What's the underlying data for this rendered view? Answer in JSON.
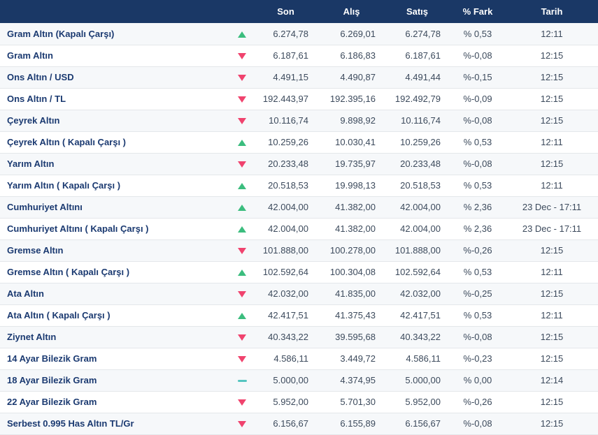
{
  "table": {
    "columns": {
      "name": "",
      "trend": "",
      "son": "Son",
      "alis": "Alış",
      "satis": "Satış",
      "fark": "% Fark",
      "tarih": "Tarih"
    },
    "rows": [
      {
        "name": "Gram Altın (Kapalı Çarşı)",
        "trend": "up",
        "son": "6.274,78",
        "alis": "6.269,01",
        "satis": "6.274,78",
        "fark": "% 0,53",
        "tarih": "12:11"
      },
      {
        "name": "Gram Altın",
        "trend": "down",
        "son": "6.187,61",
        "alis": "6.186,83",
        "satis": "6.187,61",
        "fark": "%-0,08",
        "tarih": "12:15"
      },
      {
        "name": "Ons Altın / USD",
        "trend": "down",
        "son": "4.491,15",
        "alis": "4.490,87",
        "satis": "4.491,44",
        "fark": "%-0,15",
        "tarih": "12:15"
      },
      {
        "name": "Ons Altın / TL",
        "trend": "down",
        "son": "192.443,97",
        "alis": "192.395,16",
        "satis": "192.492,79",
        "fark": "%-0,09",
        "tarih": "12:15"
      },
      {
        "name": "Çeyrek Altın",
        "trend": "down",
        "son": "10.116,74",
        "alis": "9.898,92",
        "satis": "10.116,74",
        "fark": "%-0,08",
        "tarih": "12:15"
      },
      {
        "name": "Çeyrek Altın ( Kapalı Çarşı )",
        "trend": "up",
        "son": "10.259,26",
        "alis": "10.030,41",
        "satis": "10.259,26",
        "fark": "% 0,53",
        "tarih": "12:11"
      },
      {
        "name": "Yarım Altın",
        "trend": "down",
        "son": "20.233,48",
        "alis": "19.735,97",
        "satis": "20.233,48",
        "fark": "%-0,08",
        "tarih": "12:15"
      },
      {
        "name": "Yarım Altın ( Kapalı Çarşı )",
        "trend": "up",
        "son": "20.518,53",
        "alis": "19.998,13",
        "satis": "20.518,53",
        "fark": "% 0,53",
        "tarih": "12:11"
      },
      {
        "name": "Cumhuriyet Altını",
        "trend": "up",
        "son": "42.004,00",
        "alis": "41.382,00",
        "satis": "42.004,00",
        "fark": "% 2,36",
        "tarih": "23 Dec - 17:11"
      },
      {
        "name": "Cumhuriyet Altını ( Kapalı Çarşı )",
        "trend": "up",
        "son": "42.004,00",
        "alis": "41.382,00",
        "satis": "42.004,00",
        "fark": "% 2,36",
        "tarih": "23 Dec - 17:11"
      },
      {
        "name": "Gremse Altın",
        "trend": "down",
        "son": "101.888,00",
        "alis": "100.278,00",
        "satis": "101.888,00",
        "fark": "%-0,26",
        "tarih": "12:15"
      },
      {
        "name": "Gremse Altın ( Kapalı Çarşı )",
        "trend": "up",
        "son": "102.592,64",
        "alis": "100.304,08",
        "satis": "102.592,64",
        "fark": "% 0,53",
        "tarih": "12:11"
      },
      {
        "name": "Ata Altın",
        "trend": "down",
        "son": "42.032,00",
        "alis": "41.835,00",
        "satis": "42.032,00",
        "fark": "%-0,25",
        "tarih": "12:15"
      },
      {
        "name": "Ata Altın ( Kapalı Çarşı )",
        "trend": "up",
        "son": "42.417,51",
        "alis": "41.375,43",
        "satis": "42.417,51",
        "fark": "% 0,53",
        "tarih": "12:11"
      },
      {
        "name": "Ziynet Altın",
        "trend": "down",
        "son": "40.343,22",
        "alis": "39.595,68",
        "satis": "40.343,22",
        "fark": "%-0,08",
        "tarih": "12:15"
      },
      {
        "name": "14 Ayar Bilezik Gram",
        "trend": "down",
        "son": "4.586,11",
        "alis": "3.449,72",
        "satis": "4.586,11",
        "fark": "%-0,23",
        "tarih": "12:15"
      },
      {
        "name": "18 Ayar Bilezik Gram",
        "trend": "flat",
        "son": "5.000,00",
        "alis": "4.374,95",
        "satis": "5.000,00",
        "fark": "% 0,00",
        "tarih": "12:14"
      },
      {
        "name": "22 Ayar Bilezik Gram",
        "trend": "down",
        "son": "5.952,00",
        "alis": "5.701,30",
        "satis": "5.952,00",
        "fark": "%-0,26",
        "tarih": "12:15"
      },
      {
        "name": "Serbest 0.995 Has Altın TL/Gr",
        "trend": "down",
        "son": "6.156,67",
        "alis": "6.155,89",
        "satis": "6.156,67",
        "fark": "%-0,08",
        "tarih": "12:15"
      }
    ]
  },
  "colors": {
    "trend_up": "#3bbd7e",
    "trend_down": "#f0436e",
    "trend_flat": "#55c5c0",
    "header_bg": "#1a3866",
    "name_text": "#1b3a71",
    "value_text": "#3c4a5c"
  }
}
